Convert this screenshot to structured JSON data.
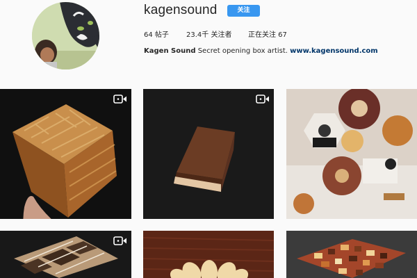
{
  "profile": {
    "username": "kagensound",
    "follow_label": "关注",
    "stats": {
      "posts": "64 帖子",
      "followers": "23.4千 关注者",
      "following": "正在关注 67"
    },
    "bio": {
      "name": "Kagen Sound",
      "text": "Secret opening box artist.",
      "link": "www.kagensound.com"
    }
  },
  "posts": [
    {
      "kind": "video",
      "icon": "video-camera-icon",
      "subject": "striped puzzle box in hand"
    },
    {
      "kind": "video",
      "icon": "video-camera-icon",
      "subject": "small walnut cube"
    },
    {
      "kind": "image",
      "subject": "wooden gear mechanism"
    },
    {
      "kind": "video",
      "icon": "video-camera-icon",
      "subject": "lattice tray box"
    },
    {
      "kind": "image",
      "subject": "flower shaped puzzle"
    },
    {
      "kind": "image",
      "subject": "mosaic cube"
    }
  ],
  "colors": {
    "accent": "#3897f0",
    "background": "#fafafa",
    "link": "#003569"
  }
}
